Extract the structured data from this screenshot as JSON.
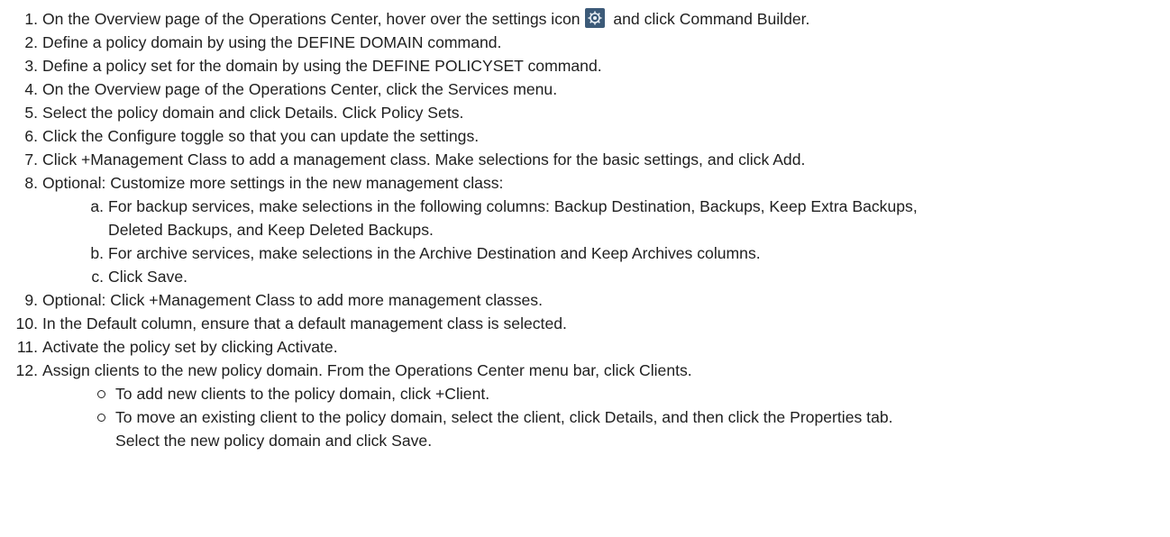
{
  "steps": [
    {
      "n": "1.",
      "pre": "On the Overview page of the Operations Center, hover over the settings icon",
      "icon": "settings-icon",
      "post": "and click Command Builder."
    },
    {
      "n": "2.",
      "text": "Define a policy domain by using the DEFINE DOMAIN command."
    },
    {
      "n": "3.",
      "text": "Define a policy set for the domain by using the DEFINE POLICYSET command."
    },
    {
      "n": "4.",
      "text": "On the Overview page of the Operations Center, click the Services menu."
    },
    {
      "n": "5.",
      "text": "Select the policy domain and click Details. Click Policy Sets."
    },
    {
      "n": "6.",
      "text": "Click the Configure toggle so that you can update the settings."
    },
    {
      "n": "7.",
      "text": "Click +Management Class to add a management class. Make selections for the basic settings, and click Add."
    },
    {
      "n": "8.",
      "text": "Optional: Customize more settings in the new management class:"
    },
    {
      "n": "9.",
      "text": "Optional: Click +Management Class to add more management classes."
    },
    {
      "n": "10.",
      "text": "In the Default column, ensure that a default management class is selected."
    },
    {
      "n": "11.",
      "text": "Activate the policy set by clicking Activate."
    },
    {
      "n": "12.",
      "text": "Assign clients to the new policy domain. From the Operations Center menu bar, click Clients."
    }
  ],
  "substeps": [
    {
      "n": "a.",
      "text": "For backup services, make selections in the following columns: Backup Destination, Backups, Keep Extra Backups,",
      "cont": "Deleted Backups, and Keep Deleted Backups."
    },
    {
      "n": "b.",
      "text": "For archive services, make selections in the Archive Destination and Keep Archives columns."
    },
    {
      "n": "c.",
      "text": "Click Save."
    }
  ],
  "bullets": [
    {
      "text": "To add new clients to the policy domain, click +Client."
    },
    {
      "text": "To move an existing client to the policy domain, select the client, click Details, and then click the Properties tab.",
      "cont": "Select the new policy domain and click Save."
    }
  ],
  "colors": {
    "text": "#1f1f1f",
    "icon_bg": "#3c5a78"
  }
}
